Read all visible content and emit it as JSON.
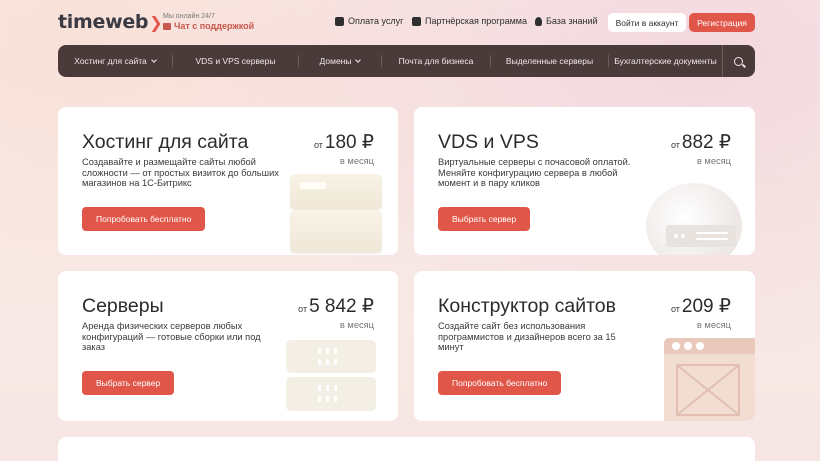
{
  "header": {
    "logo": "timeweb",
    "support_small": "Мы онлайн 24/7",
    "support_chat": "Чат с поддержкой",
    "links": [
      {
        "label": "Оплата услуг",
        "icon": "wallet-icon"
      },
      {
        "label": "Партнёрская программа",
        "icon": "partner-icon"
      },
      {
        "label": "База знаний",
        "icon": "lightbulb-icon"
      }
    ],
    "login": "Войти в аккаунт",
    "register": "Регистрация"
  },
  "menu": {
    "items": [
      {
        "label": "Хостинг для сайта",
        "dropdown": true
      },
      {
        "label": "VDS и VPS серверы",
        "dropdown": false
      },
      {
        "label": "Домены",
        "dropdown": true
      },
      {
        "label": "Почта для бизнеса",
        "dropdown": false
      },
      {
        "label": "Выделенные серверы",
        "dropdown": false
      },
      {
        "label": "Бухгалтерские документы",
        "dropdown": false
      }
    ],
    "search_icon": "search-icon"
  },
  "cards": [
    {
      "title": "Хостинг для сайта",
      "desc": "Создавайте и размещайте сайты любой сложности — от простых визиток до больших магазинов на 1С-Битрикс",
      "from": "от",
      "price": "180 ₽",
      "per": "в месяц",
      "button": "Попробовать бесплатно"
    },
    {
      "title": "VDS и VPS",
      "desc": "Виртуальные серверы с почасовой оплатой. Меняйте конфигурацию сервера в любой момент и в пару кликов",
      "from": "от",
      "price": "882 ₽",
      "per": "в месяц",
      "button": "Выбрать сервер"
    },
    {
      "title": "Серверы",
      "desc": "Аренда физических серверов любых конфигураций — готовые сборки или под заказ",
      "from": "от",
      "price": "5 842 ₽",
      "per": "в месяц",
      "button": "Выбрать сервер"
    },
    {
      "title": "Конструктор сайтов",
      "desc": "Создайте сайт без использования программистов и дизайнеров всего за 15 минут",
      "from": "от",
      "price": "209 ₽",
      "per": "в месяц",
      "button": "Попробовать бесплатно"
    }
  ],
  "colors": {
    "accent": "#e0574a",
    "menu_bg": "#4a3a3a"
  }
}
